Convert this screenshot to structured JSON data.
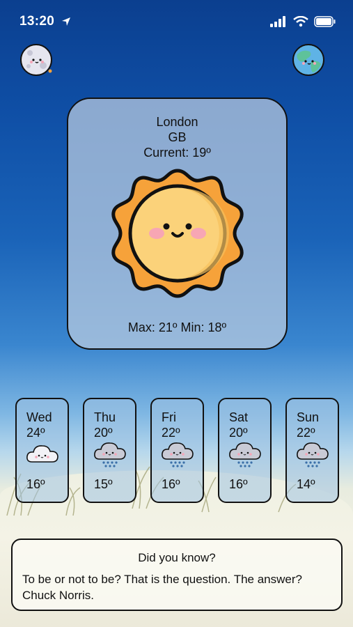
{
  "status_bar": {
    "time": "13:20",
    "icons": [
      "location-arrow-icon",
      "signal-icon",
      "wifi-icon",
      "battery-icon"
    ]
  },
  "header": {
    "left_icon": "moon-icon",
    "right_icon": "earth-icon"
  },
  "current": {
    "city": "London",
    "country": "GB",
    "current_label": "Current: 19º",
    "icon": "sun-icon",
    "max_min": "Max: 21º Min: 18º"
  },
  "forecast": [
    {
      "day": "Wed",
      "high": "24º",
      "low": "16º",
      "icon": "cloud-icon"
    },
    {
      "day": "Thu",
      "high": "20º",
      "low": "15º",
      "icon": "snow-cloud-icon"
    },
    {
      "day": "Fri",
      "high": "22º",
      "low": "16º",
      "icon": "snow-cloud-icon"
    },
    {
      "day": "Sat",
      "high": "20º",
      "low": "16º",
      "icon": "snow-cloud-icon"
    },
    {
      "day": "Sun",
      "high": "22º",
      "low": "14º",
      "icon": "snow-cloud-icon"
    }
  ],
  "fact": {
    "title": "Did you know?",
    "text": "To be or not to be? That is the question. The answer? Chuck Norris."
  },
  "colors": {
    "sky_top": "#0b3f8f",
    "sun_orange": "#f6a23a",
    "sun_yellow": "#fbd27a",
    "card_outline": "#111111"
  }
}
